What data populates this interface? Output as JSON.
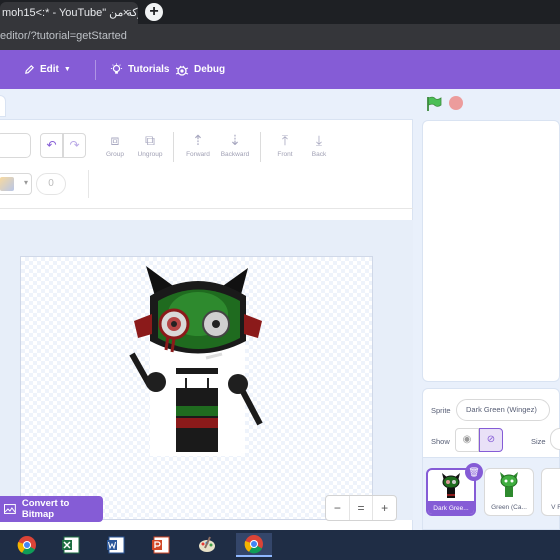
{
  "browser": {
    "tab_title": "moh15<:* - YouTube\" مشاركة من",
    "tab_close": "×",
    "new_tab": "+",
    "url": "editor/?tutorial=getStarted"
  },
  "menubar": {
    "edit_label": "Edit",
    "tutorials_label": "Tutorials",
    "debug_label": "Debug"
  },
  "paint_editor": {
    "tools": {
      "group": "Group",
      "ungroup": "Ungroup",
      "forward": "Forward",
      "backward": "Backward",
      "front": "Front",
      "back": "Back"
    },
    "outline_size": "0",
    "convert_label": "Convert to Bitmap",
    "zoom": {
      "out": "−",
      "reset": "=",
      "in": "+"
    }
  },
  "sprite_info": {
    "sprite_label": "Sprite",
    "sprite_name": "Dark Green (Wingez)",
    "show_label": "Show",
    "size_label": "Size"
  },
  "sprites": [
    {
      "name": "Dark Gree..."
    },
    {
      "name": "Green (Ca..."
    },
    {
      "name": "V Re..."
    }
  ],
  "colors": {
    "accent": "#855cd6",
    "stage_bg": "#e9f0fb",
    "green_flag": "#4cbf56",
    "stop": "#ec9c9c"
  },
  "taskbar": {
    "icons": [
      "chrome-icon",
      "excel-icon",
      "word-icon",
      "powerpoint-icon",
      "paint-icon",
      "chrome-window-icon"
    ]
  }
}
